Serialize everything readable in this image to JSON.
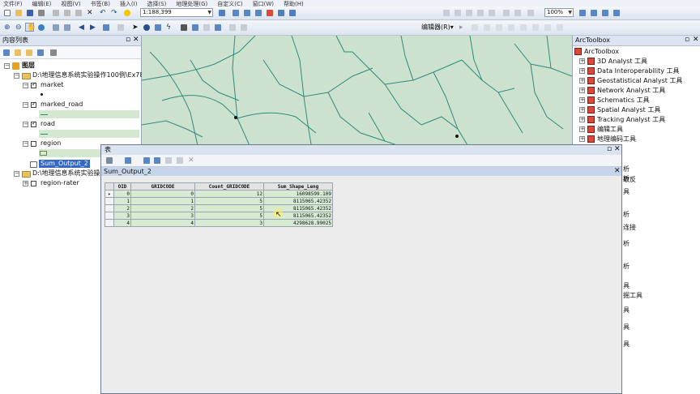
{
  "menubar": {
    "items": [
      "文件(F)",
      "编辑(E)",
      "视图(V)",
      "书签(B)",
      "插入(I)",
      "选择(S)",
      "地理处理(G)",
      "自定义(C)",
      "窗口(W)",
      "帮助(H)"
    ]
  },
  "toolbar": {
    "scale_value": "1:188,399",
    "zoom_value": "100%",
    "editor_label": "编辑器(R)▾"
  },
  "toc": {
    "title": "内容列表",
    "root_label": "图层",
    "path1_label": "D:\\地理信息系统实验操作100例\\Ex78",
    "path2_label": "D:\\地理信息系统实验操作",
    "layers": [
      "market",
      "marked_road",
      "road",
      "region"
    ],
    "table_item": "Sum_Output_2",
    "region_raster": "region-rater"
  },
  "arctoolbox": {
    "title": "ArcToolbox",
    "root": "ArcToolbox",
    "items": [
      "3D Analyst 工具",
      "Data Interoperability 工具",
      "Geostatistical Analyst 工具",
      "Network Analyst 工具",
      "Schematics 工具",
      "Spatial Analyst 工具",
      "Tracking Analyst 工具",
      "编辑工具",
      "地理编码工具"
    ],
    "partial_items": [
      "析",
      "析",
      "取反",
      "具",
      "析",
      "连接",
      "析",
      "析",
      "具",
      "掘工具",
      "具",
      "具",
      "具"
    ]
  },
  "table_window": {
    "title": "表",
    "tab_label": "Sum_Output_2",
    "columns": [
      "OID",
      "GRIDCODE",
      "Count_GRIDCODE",
      "Sum_Shape_Leng"
    ],
    "rows": [
      [
        "0",
        "0",
        "12",
        "16098599.109"
      ],
      [
        "1",
        "1",
        "5",
        "8115065.42352"
      ],
      [
        "2",
        "2",
        "5",
        "8115065.42352"
      ],
      [
        "3",
        "3",
        "5",
        "8115065.42352"
      ],
      [
        "4",
        "4",
        "3",
        "4298628.99025"
      ]
    ]
  },
  "colors": {
    "map_bg": "#cde1cf",
    "road": "#2e8b7a",
    "row_bg": "#d6ebd2",
    "title_bar": "#dae3ef"
  }
}
